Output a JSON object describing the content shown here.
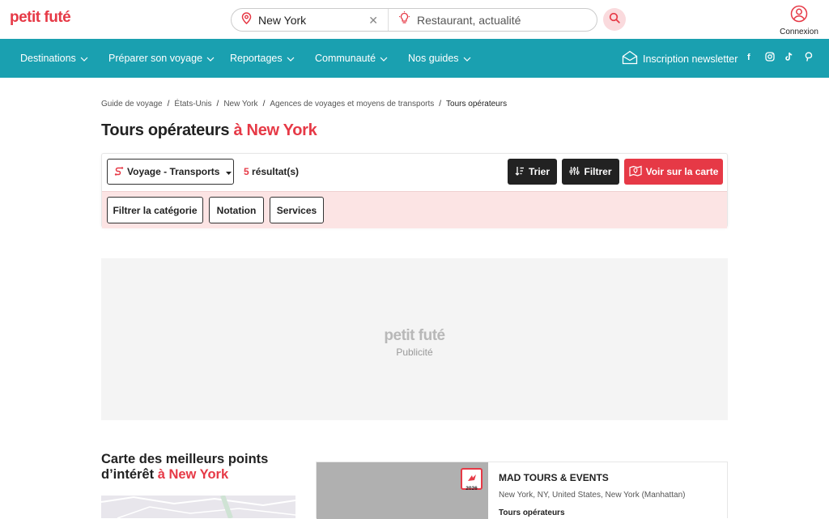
{
  "header": {
    "logo": "petit futé",
    "search_location_value": "New York",
    "search_query_placeholder": "Restaurant, actualité",
    "account_label": "Connexion"
  },
  "nav": {
    "items": [
      {
        "label": "Destinations"
      },
      {
        "label": "Préparer son voyage"
      },
      {
        "label": "Reportages"
      },
      {
        "label": "Communauté"
      },
      {
        "label": "Nos guides"
      }
    ],
    "newsletter_label": "Inscription newsletter",
    "social": [
      "facebook-icon",
      "instagram-icon",
      "tiktok-icon",
      "pinterest-icon"
    ]
  },
  "breadcrumb": {
    "items": [
      "Guide de voyage",
      "États-Unis",
      "New York",
      "Agences de voyages et moyens de transports",
      "Tours opérateurs"
    ]
  },
  "page": {
    "title_main": "Tours opérateurs ",
    "title_place": "à New York"
  },
  "filters": {
    "category_dropdown": "Voyage - Transports",
    "result_count": "5",
    "result_label": " résultat(s)",
    "sort_label": "Trier",
    "filter_label": "Filtrer",
    "map_label": "Voir sur la carte",
    "chips": [
      "Filtrer la catégorie",
      "Notation",
      "Services"
    ]
  },
  "ad": {
    "logo": "petit futé",
    "label": "Publicité"
  },
  "map_section": {
    "title_main": "Carte des meilleurs points d’intérêt ",
    "title_place": "à New York"
  },
  "listing": {
    "badge_year": "2026",
    "name": "MAD TOURS & EVENTS",
    "address": "New York, NY, United States, New York (Manhattan)",
    "category": "Tours opérateurs"
  },
  "colors": {
    "brand_red": "#e63946",
    "nav_teal": "#1aa0b0"
  }
}
